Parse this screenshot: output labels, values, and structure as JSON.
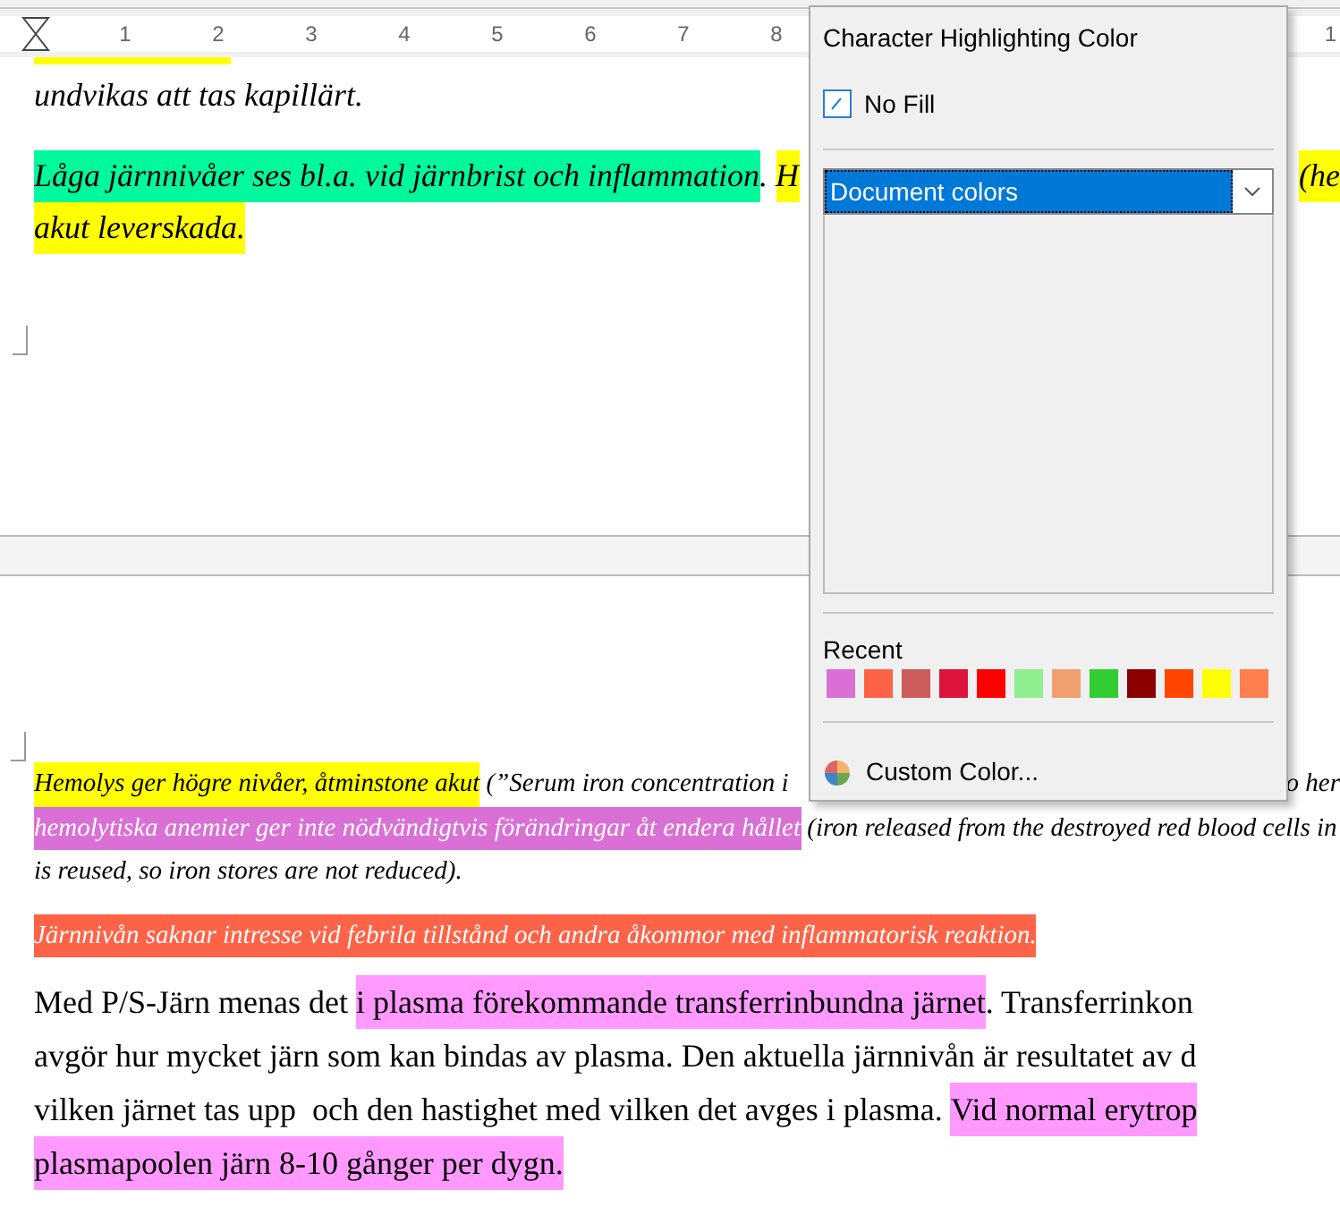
{
  "ruler": {
    "numbers": [
      "1",
      "2",
      "3",
      "4",
      "5",
      "6",
      "7",
      "8"
    ],
    "edge_number": "1"
  },
  "pages": [
    {
      "lines": [
        {
          "kind": "large_italic",
          "left": [
            {
              "text": "undvikas att tas kapillärt."
            }
          ]
        },
        {
          "kind": "large_italic",
          "left": [
            {
              "text": "Låga järnnivåer ses bl.a. vid järnbrist och inflammation",
              "color": "#00f99d"
            },
            {
              "text": ". "
            },
            {
              "text": "H",
              "color": "#ffff00"
            }
          ],
          "right": [
            {
              "text": "(he",
              "color": "#ffff00"
            }
          ]
        },
        {
          "kind": "large_italic",
          "left": [
            {
              "text": "akut leverskada.",
              "color": "#ffff00"
            }
          ]
        }
      ]
    },
    {
      "lines": [
        {
          "kind": "small_italic",
          "left": [
            {
              "text": "Hemolys ger högre nivåer, åtminstone akut",
              "color": "#ffff00"
            },
            {
              "text": " (”Serum iron concentration i"
            }
          ],
          "right": [
            {
              "text": "o her"
            }
          ]
        },
        {
          "kind": "small_italic",
          "left": [
            {
              "text": "hemolytiska anemier ger inte nödvändigtvis förändringar åt endera hållet",
              "color": "#da70d6",
              "light_text": true
            },
            {
              "text": " (iron released from the destroyed red blood cells in"
            }
          ]
        },
        {
          "kind": "small_italic",
          "left": [
            {
              "text": "is reused, so iron stores are not reduced)."
            }
          ]
        },
        {
          "kind": "small_gap",
          "left": [
            {
              "text": "Järnnivån saknar intresse vid febrila tillstånd och andra åkommor med inflammatorisk reaktion.",
              "color": "#ff6347",
              "light_text": true
            }
          ]
        },
        {
          "kind": "large_gap",
          "left": [
            {
              "text": "Med P/S-Järn menas det "
            },
            {
              "text": "i plasma förekommande transferrinbundna järnet",
              "color": "#ff99ff"
            },
            {
              "text": ". Transferrinkon"
            }
          ]
        },
        {
          "kind": "large",
          "left": [
            {
              "text": "avgör hur mycket järn som kan bindas av plasma. Den aktuella järnnivån är resultatet av d"
            }
          ]
        },
        {
          "kind": "large",
          "left": [
            {
              "text": "vilken järnet tas upp  och den hastighet med vilken det avges i plasma. "
            },
            {
              "text": "Vid normal erytrop",
              "color": "#ff99ff"
            }
          ]
        },
        {
          "kind": "large",
          "left": [
            {
              "text": "plasmapoolen järn 8-10 gånger per dygn.",
              "color": "#ff99ff"
            }
          ]
        }
      ]
    }
  ],
  "popup": {
    "title": "Character Highlighting Color",
    "no_fill": "No Fill",
    "palette_select": {
      "value": "Document colors",
      "selected": true
    },
    "recent_label": "Recent",
    "recent": [
      {
        "color": "#da70d6"
      },
      {
        "color": "#ff6347"
      },
      {
        "color": "#cd5c5c"
      },
      {
        "color": "#dc143c"
      },
      {
        "color": "#ff0000"
      },
      {
        "color": "#90ee90"
      },
      {
        "color": "#f0a070"
      },
      {
        "color": "#32cd32"
      },
      {
        "color": "#8b0000"
      },
      {
        "color": "#ff4500"
      },
      {
        "color": "#ffff00"
      },
      {
        "color": "#ff7f50"
      }
    ],
    "custom_color": "Custom Color..."
  }
}
